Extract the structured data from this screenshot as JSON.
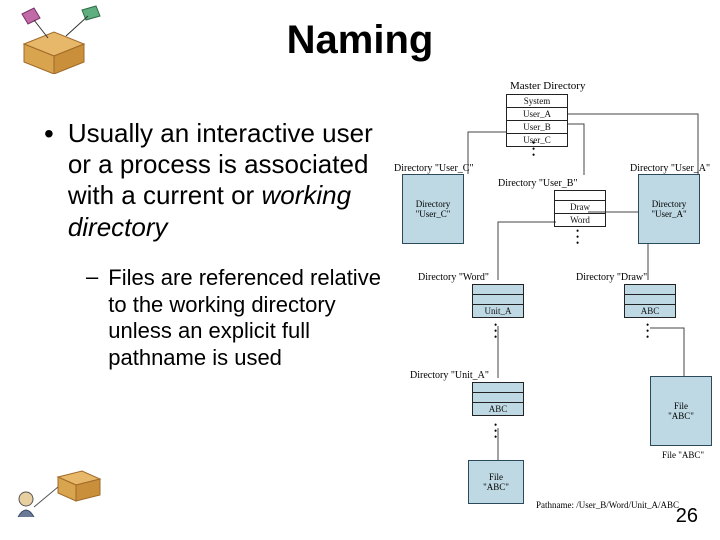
{
  "title": "Naming",
  "bullet": {
    "pre": "Usually an interactive user or a process is associated with a current or ",
    "em": "working directory"
  },
  "sub": "Files are referenced relative to the working directory unless an explicit full pathname is used",
  "page": "26",
  "diagram": {
    "master_label": "Master Directory",
    "master": [
      "System",
      "User_A",
      "User_B",
      "User_C"
    ],
    "row1": {
      "left": {
        "label": "Directory \"User_C\"",
        "box": "Directory\n\"User_C\""
      },
      "mid": {
        "label": "Directory \"User_B\"",
        "cells": [
          "",
          "Draw",
          "Word"
        ]
      },
      "right": {
        "label": "Directory \"User_A\"",
        "box": "Directory\n\"User_A\""
      }
    },
    "row2": {
      "left": {
        "label": "Directory \"Word\"",
        "cells": [
          "",
          "",
          "Unit_A"
        ]
      },
      "right": {
        "label": "Directory \"Draw\"",
        "cells": [
          "",
          "",
          "ABC"
        ]
      }
    },
    "row3": {
      "left": {
        "label": "Directory \"Unit_A\"",
        "cells": [
          "",
          "",
          "ABC"
        ]
      },
      "right": {
        "label": "File \"ABC\"",
        "box": "File\n\"ABC\""
      }
    },
    "row4": {
      "box": "File\n\"ABC\""
    },
    "pathname": "Pathname: /User_B/Word/Unit_A/ABC"
  }
}
